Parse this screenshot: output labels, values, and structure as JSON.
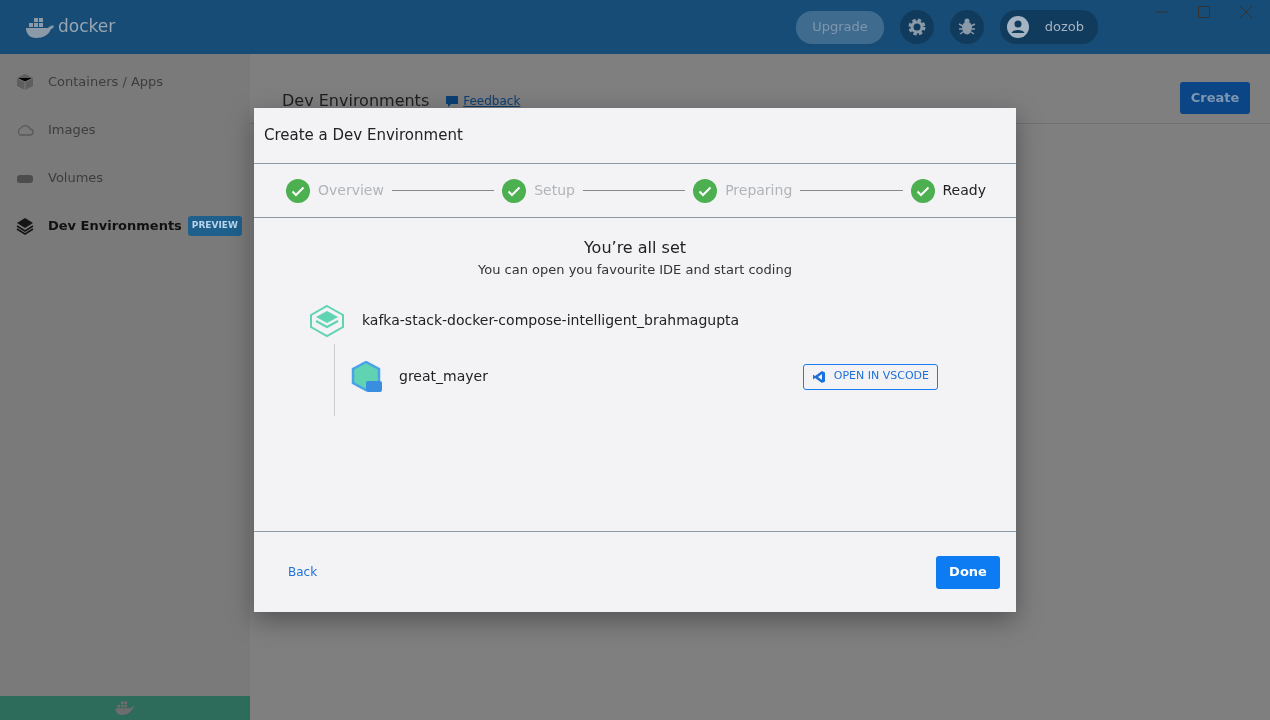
{
  "topbar": {
    "logo": "docker",
    "upgrade": "Upgrade",
    "user": "dozob"
  },
  "sidebar": {
    "items": [
      {
        "label": "Containers / Apps",
        "kind": "containers",
        "selected": false
      },
      {
        "label": "Images",
        "kind": "images",
        "selected": false
      },
      {
        "label": "Volumes",
        "kind": "volumes",
        "selected": false
      },
      {
        "label": "Dev Environments",
        "kind": "dev",
        "selected": true,
        "badge": "PREVIEW"
      }
    ]
  },
  "page": {
    "title": "Dev Environments",
    "feedback": "Feedback",
    "create": "Create"
  },
  "dialog": {
    "title": "Create a Dev Environment",
    "steps": [
      {
        "label": "Overview",
        "completed": true,
        "selected": false
      },
      {
        "label": "Setup",
        "completed": true,
        "selected": false
      },
      {
        "label": "Preparing",
        "completed": true,
        "selected": false
      },
      {
        "label": "Ready",
        "completed": true,
        "selected": true
      }
    ],
    "heading": "You’re all set",
    "subtitle": "You can open you favourite IDE and start coding",
    "project": "kafka-stack-docker-compose-intelligent_brahmagupta",
    "containers": [
      {
        "name": "great_mayer",
        "action": "OPEN IN VSCODE"
      }
    ],
    "back": "Back",
    "done": "Done"
  }
}
